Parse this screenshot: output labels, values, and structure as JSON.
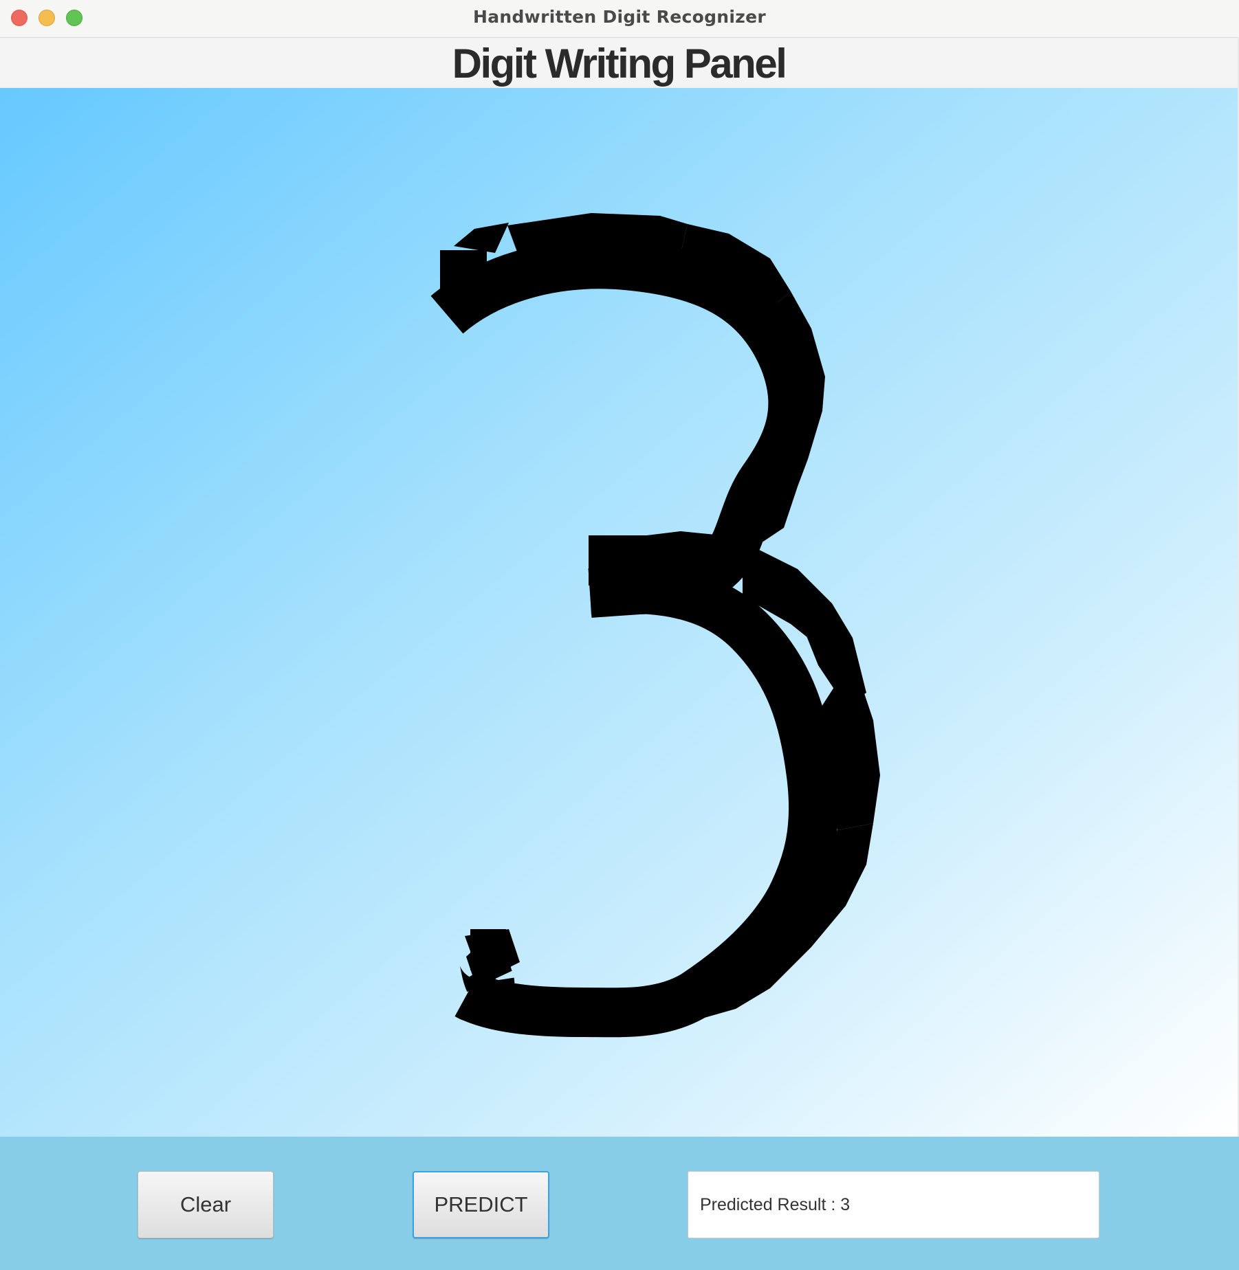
{
  "window": {
    "title": "Handwritten Digit Recognizer",
    "controls": [
      "close",
      "minimize",
      "zoom"
    ]
  },
  "header": {
    "title": "Digit Writing Panel"
  },
  "canvas": {
    "drawn_digit_icon": "handwritten-3-stroke",
    "stroke_color": "#000000",
    "background_gradient": [
      "#66c9fe",
      "#ffffff"
    ]
  },
  "toolbar": {
    "clear_label": "Clear",
    "predict_label": "PREDICT",
    "result_text": "Predicted Result : 3"
  },
  "colors": {
    "bottom_bar": "#87cde8",
    "focus_border": "#3aa3e3"
  }
}
